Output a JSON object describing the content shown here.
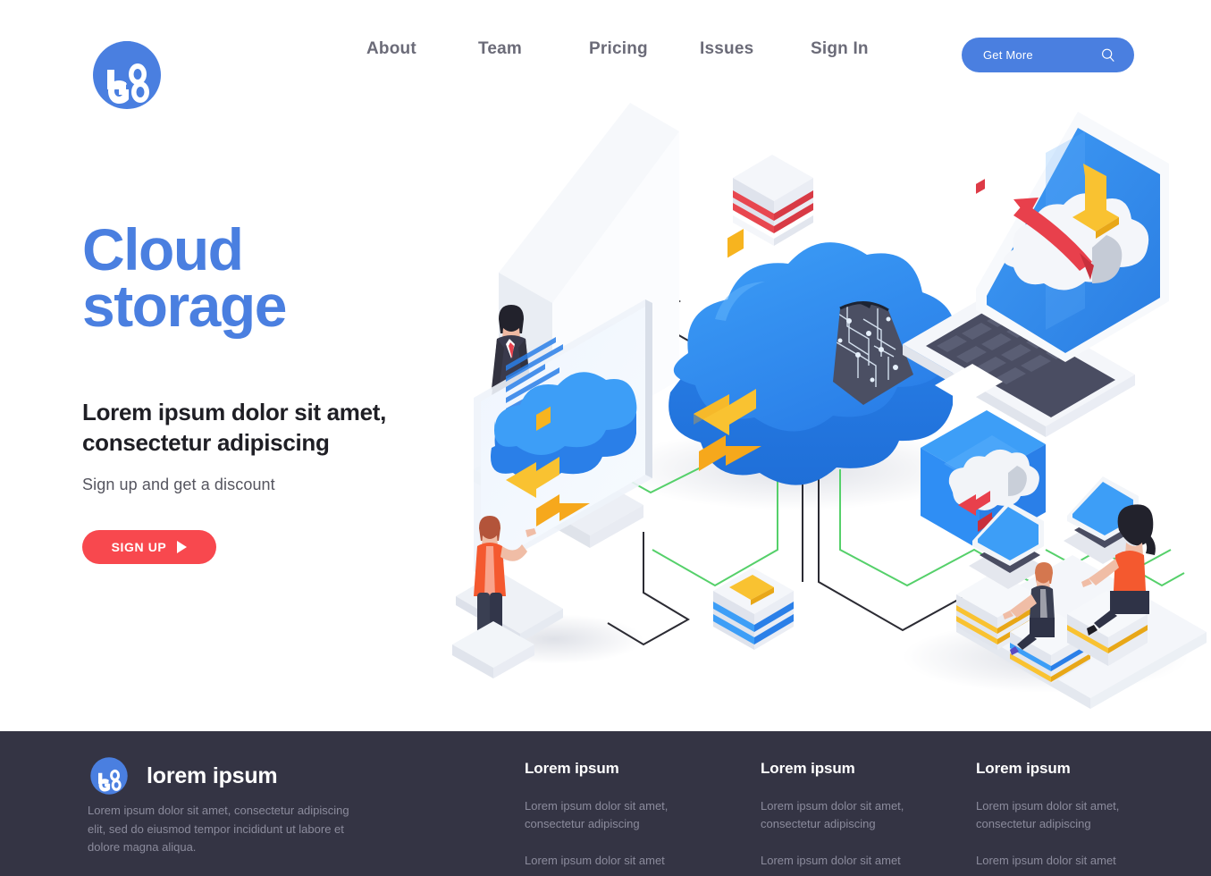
{
  "header": {
    "logo_alt": "LOGO",
    "nav": [
      {
        "label": "About"
      },
      {
        "label": "Team"
      },
      {
        "label": "Pricing"
      },
      {
        "label": "Issues"
      },
      {
        "label": "Sign In"
      }
    ],
    "cta": {
      "label": "Get More",
      "icon": "search-icon"
    }
  },
  "hero": {
    "title_line1": "Cloud",
    "title_line2": "storage",
    "subtitle": "Lorem ipsum dolor sit amet, consectetur adipiscing",
    "note": "Sign up and get a discount",
    "button": {
      "label": "SIGN UP",
      "icon": "play-icon"
    }
  },
  "illustration": {
    "alt": "Isometric cloud storage illustration with servers, laptop, monitors and people"
  },
  "footer": {
    "logo_alt": "LOGO",
    "brand": "lorem ipsum",
    "description": "Lorem ipsum dolor sit amet, consectetur adipiscing elit, sed do eiusmod tempor incididunt ut labore et dolore magna aliqua.",
    "columns": [
      {
        "title": "Lorem ipsum",
        "links": [
          "Lorem ipsum dolor sit amet, consectetur adipiscing",
          "Lorem ipsum dolor sit amet"
        ]
      },
      {
        "title": "Lorem ipsum",
        "links": [
          "Lorem ipsum dolor sit amet, consectetur adipiscing",
          "Lorem ipsum dolor sit amet"
        ]
      },
      {
        "title": "Lorem ipsum",
        "links": [
          "Lorem ipsum dolor sit amet, consectetur adipiscing",
          "Lorem ipsum dolor sit amet"
        ]
      }
    ]
  },
  "colors": {
    "brand_blue": "#4a7fe0",
    "accent_red": "#f8484e",
    "footer_bg": "#343444",
    "nav_text": "#6b6b78",
    "heading_dark": "#1f1f25",
    "muted_text": "#8b8b9c",
    "cloud_blue": "#2f8ef4",
    "arrow_orange": "#f8b72b",
    "wire_green": "#55d06a",
    "wire_dark": "#2b2b33"
  }
}
